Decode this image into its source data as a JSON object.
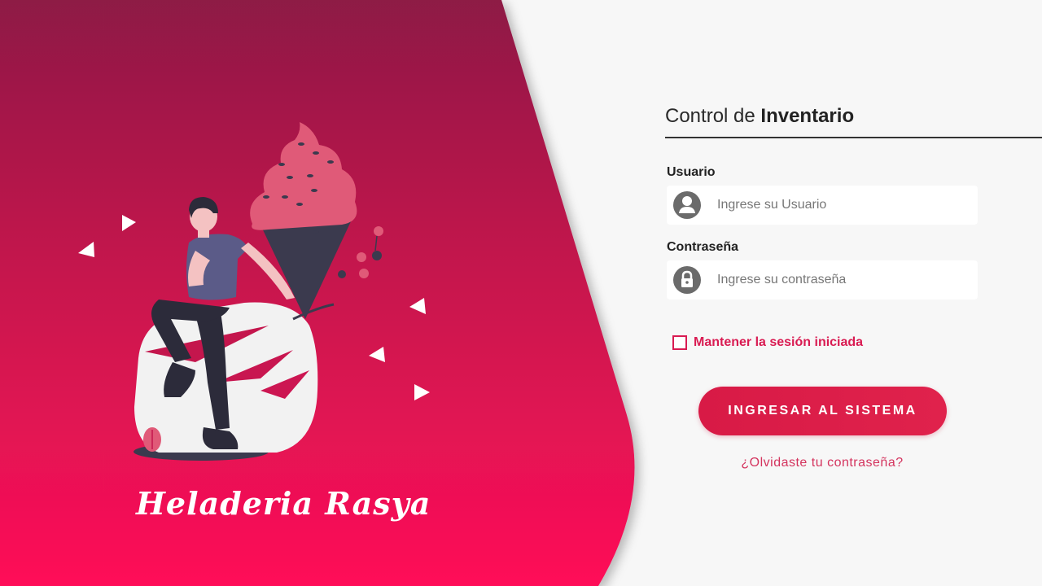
{
  "brand": {
    "name": "Heladeria Rasya",
    "colors": {
      "panel_top": "#8e1a45",
      "panel_bottom": "#ff0f58",
      "accent": "#d91b52",
      "icecream": "#e05a78",
      "cone": "#3b3a4e"
    }
  },
  "login": {
    "heading_light": "Control de ",
    "heading_bold": "Inventario",
    "username": {
      "label": "Usuario",
      "placeholder": "Ingrese su Usuario",
      "icon": "user-icon"
    },
    "password": {
      "label": "Contraseña",
      "placeholder": "Ingrese su contraseña",
      "icon": "lock-icon"
    },
    "remember_label": "Mantener la sesión iniciada",
    "remember_checked": false,
    "submit_label": "INGRESAR AL SISTEMA",
    "forgot_label": "¿Olvidaste tu contraseña?"
  }
}
